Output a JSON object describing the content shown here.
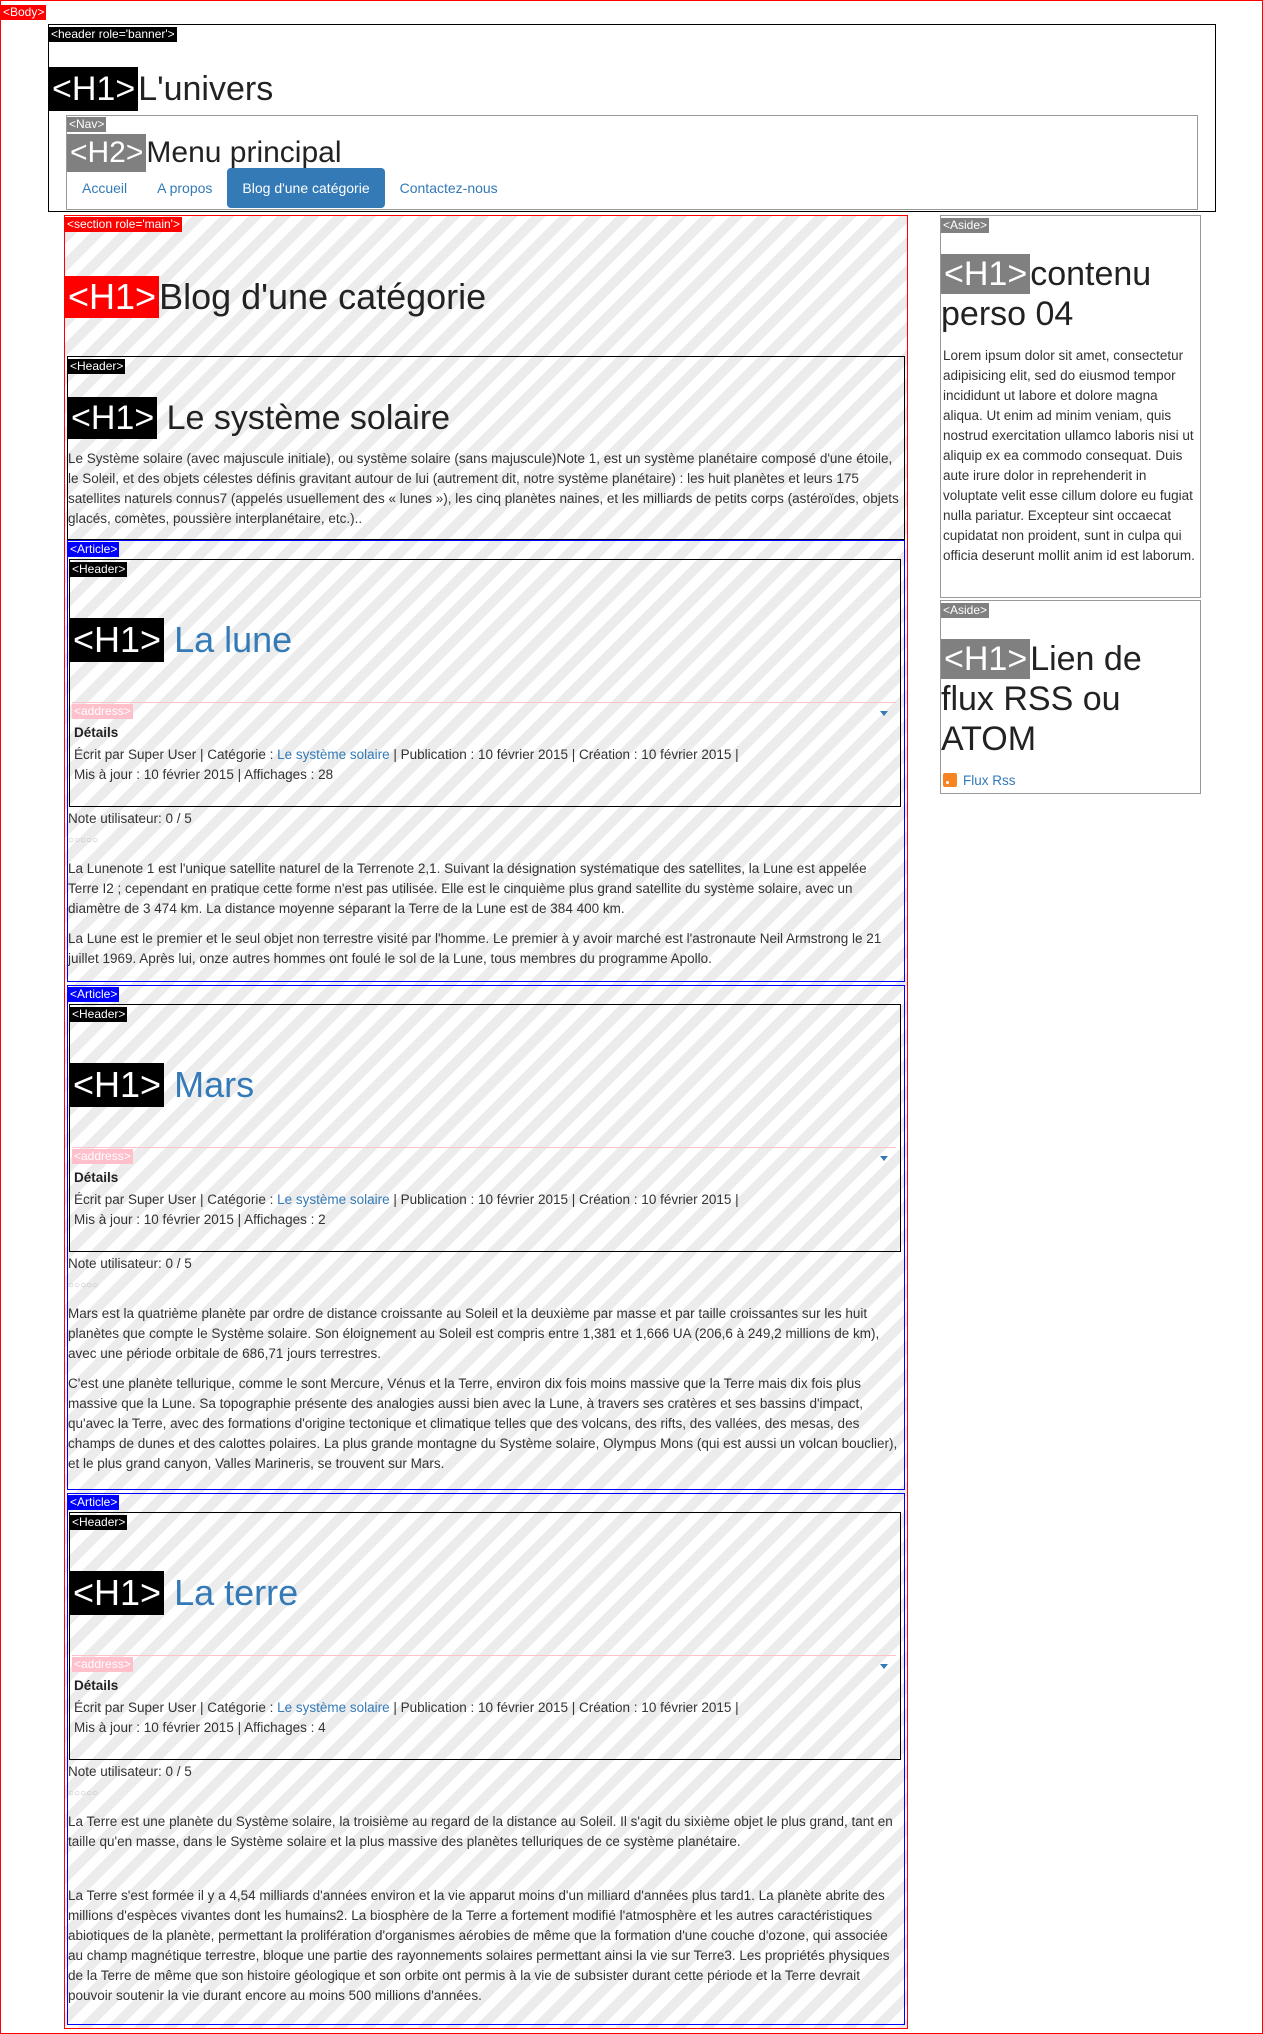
{
  "tags": {
    "body": "<Body>",
    "banner": "<header role='banner'>",
    "h1": "<H1>",
    "h2": "<H2>",
    "nav": "<Nav>",
    "main": "<section role='main'>",
    "header": "<Header>",
    "article": "<Article>",
    "address": "<address>",
    "aside": "<Aside>"
  },
  "site": {
    "title": "L'univers"
  },
  "nav": {
    "title": "Menu principal",
    "links": [
      "Accueil",
      "A propos",
      "Blog d'une catégorie",
      "Contactez-nous"
    ]
  },
  "main": {
    "title": "Blog d'une catégorie",
    "category": {
      "title": " Le système solaire",
      "description": "Le Système solaire (avec majuscule initiale), ou système solaire (sans majuscule)Note 1, est un système planétaire composé d'une étoile, le Soleil, et des objets célestes définis gravitant autour de lui (autrement dit, notre système planétaire) : les huit planètes et leurs 175 satellites naturels connus7 (appelés usuellement des « lunes »), les cinq planètes naines, et les milliards de petits corps (astéroïdes, objets glacés, comètes, poussière interplanétaire, etc.).."
    }
  },
  "articles": [
    {
      "title": " La lune",
      "details_label": "Détails",
      "written_by": "Écrit par Super User | Catégorie : ",
      "category_link": "Le système solaire",
      "dates": " | Publication : 10 février 2015 | Création : 10 février 2015 |",
      "updated": "Mis à jour : 10 février 2015 | Affichages : 28",
      "rating": "Note utilisateur:  0 / 5",
      "stars": "○○○○○",
      "paragraphs": [
        "La Lunenote 1 est l'unique satellite naturel de la Terrenote 2,1. Suivant la désignation systématique des satellites, la Lune est appelée Terre I2 ; cependant en pratique cette forme n'est pas utilisée. Elle est le cinquième plus grand satellite du système solaire, avec un diamètre de 3 474 km. La distance moyenne séparant la Terre de la Lune est de 384 400 km.",
        "La Lune est le premier et le seul objet non terrestre visité par l'homme. Le premier à y avoir marché est l'astronaute Neil Armstrong le 21 juillet 1969. Après lui, onze autres hommes ont foulé le sol de la Lune, tous membres du programme Apollo."
      ]
    },
    {
      "title": " Mars",
      "details_label": "Détails",
      "written_by": "Écrit par Super User | Catégorie : ",
      "category_link": "Le système solaire",
      "dates": " | Publication : 10 février 2015 | Création : 10 février 2015 |",
      "updated": "Mis à jour : 10 février 2015 | Affichages : 2",
      "rating": "Note utilisateur:  0 / 5",
      "stars": "○○○○○",
      "paragraphs": [
        "Mars est la quatrième planète par ordre de distance croissante au Soleil et la deuxième par masse et par taille croissantes sur les huit planètes que compte le Système solaire. Son éloignement au Soleil est compris entre 1,381 et 1,666 UA (206,6 à 249,2 millions de km), avec une période orbitale de 686,71 jours terrestres.",
        "C'est une planète tellurique, comme le sont Mercure, Vénus et la Terre, environ dix fois moins massive que la Terre mais dix fois plus massive que la Lune. Sa topographie présente des analogies aussi bien avec la Lune, à travers ses cratères et ses bassins d'impact, qu'avec la Terre, avec des formations d'origine tectonique et climatique telles que des volcans, des rifts, des vallées, des mesas, des champs de dunes et des calottes polaires. La plus grande montagne du Système solaire, Olympus Mons (qui est aussi un volcan bouclier), et le plus grand canyon, Valles Marineris, se trouvent sur Mars."
      ]
    },
    {
      "title": " La terre",
      "details_label": "Détails",
      "written_by": "Écrit par Super User | Catégorie : ",
      "category_link": "Le système solaire",
      "dates": " | Publication : 10 février 2015 | Création : 10 février 2015 |",
      "updated": "Mis à jour : 10 février 2015 | Affichages : 4",
      "rating": "Note utilisateur:  0 / 5",
      "stars": "○○○○○",
      "paragraphs": [
        "La Terre est une planète du Système solaire, la troisième au regard de la distance au Soleil. Il s'agit du sixième objet le plus grand, tant en taille qu'en masse, dans le Système solaire et la plus massive des planètes telluriques de ce système planétaire.",
        "La Terre s'est formée il y a 4,54 milliards d'années environ et la vie apparut moins d'un milliard d'années plus tard1. La planète abrite des millions d'espèces vivantes dont les humains2. La biosphère de la Terre a fortement modifié l'atmosphère et les autres caractéristiques abiotiques de la planète, permettant la prolifération d'organismes aérobies de même que la formation d'une couche d'ozone, qui associée au champ magnétique terrestre, bloque une partie des rayonnements solaires permettant ainsi la vie sur Terre3. Les propriétés physiques de la Terre de même que son histoire géologique et son orbite ont permis à la vie de subsister durant cette période et la Terre devrait pouvoir soutenir la vie durant encore au moins 500 millions d'années."
      ]
    }
  ],
  "aside1": {
    "title": "contenu perso 04",
    "text": "Lorem ipsum dolor sit amet, consectetur adipisicing elit, sed do eiusmod tempor incididunt ut labore et dolore magna aliqua. Ut enim ad minim veniam, quis nostrud exercitation ullamco laboris nisi ut aliquip ex ea commodo consequat. Duis aute irure dolor in reprehenderit in voluptate velit esse cillum dolore eu fugiat nulla pariatur. Excepteur sint occaecat cupidatat non proident, sunt in culpa qui officia deserunt mollit anim id est laborum."
  },
  "aside2": {
    "title": "Lien de flux RSS ou ATOM",
    "rss_link": "Flux Rss",
    "rss_icon": "rss-icon"
  }
}
